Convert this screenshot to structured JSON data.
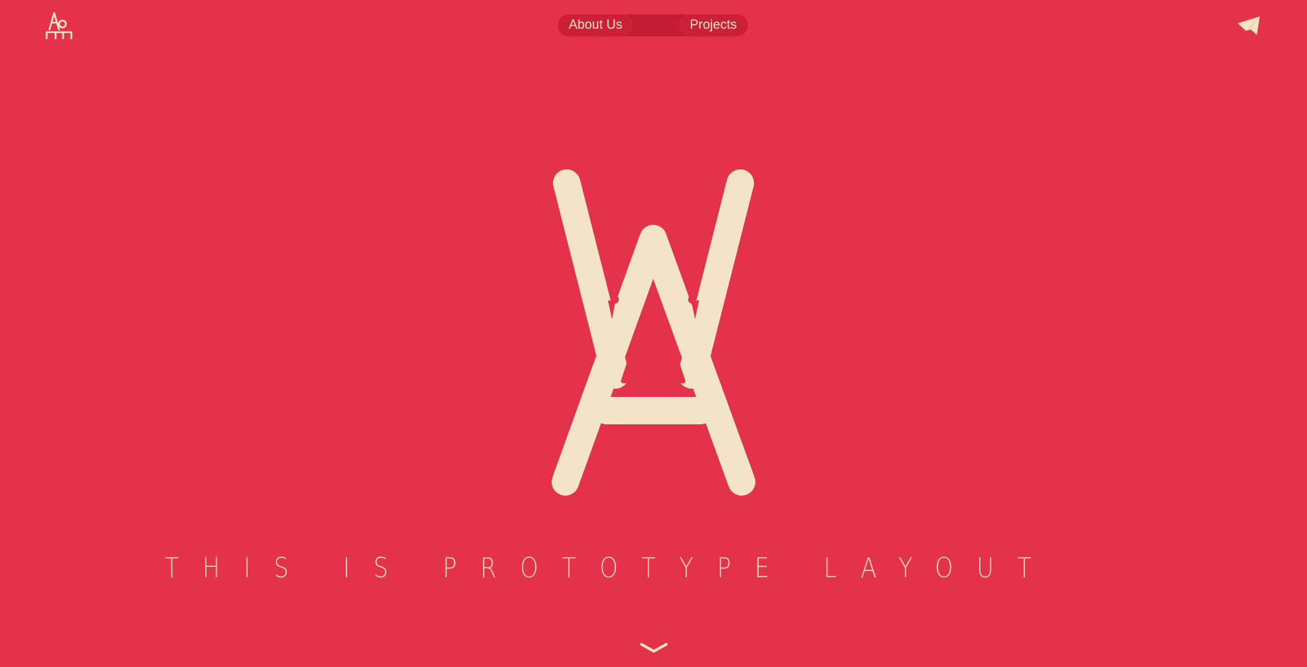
{
  "header": {
    "logo_icon": "ap-monogram-icon",
    "nav": {
      "about_label": "About Us",
      "projects_label": "Projects"
    },
    "contact_icon": "paper-plane-icon"
  },
  "hero": {
    "logo_icon": "wa-monogram-logo",
    "tagline": "THIS IS PROTOTYPE LAYOUT",
    "scroll_icon": "chevron-down-icon"
  },
  "colors": {
    "background": "#e5324b",
    "nav_background": "#c41c33",
    "accent": "#f3e4c8"
  }
}
